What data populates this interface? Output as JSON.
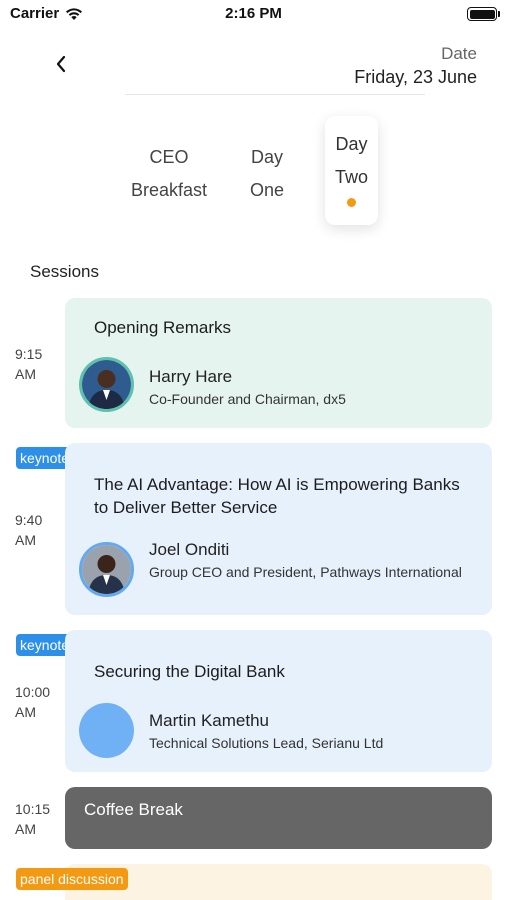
{
  "status_bar": {
    "carrier": "Carrier",
    "time": "2:16 PM"
  },
  "header": {
    "date_label": "Date",
    "date_value": "Friday, 23 June"
  },
  "tabs": [
    {
      "line1": "CEO",
      "line2": "Breakfast"
    },
    {
      "line1": "Day",
      "line2": "One"
    },
    {
      "line1": "Day",
      "line2": "Two"
    }
  ],
  "sessions_title": "Sessions",
  "sessions": [
    {
      "time": "9:15 AM",
      "title": "Opening Remarks",
      "speaker": "Harry Hare",
      "role": "Co-Founder and Chairman, dx5",
      "bg": "#e6f4f0"
    },
    {
      "badge": "keynote",
      "time": "9:40 AM",
      "title": "The AI Advantage: How AI is Empowering Banks to Deliver Better Service",
      "speaker": "Joel Onditi",
      "role": "Group CEO and President, Pathways International",
      "bg": "#e6f1fc"
    },
    {
      "badge": "keynote",
      "time": "10:00 AM",
      "title": "Securing the Digital Bank",
      "speaker": "Martin Kamethu",
      "role": "Technical Solutions Lead, Serianu Ltd",
      "bg": "#e6f1fc"
    },
    {
      "time": "10:15 AM",
      "title": "Coffee Break",
      "bg": "#666666"
    },
    {
      "badge": "panel discussion",
      "bg": "#fdf3e3"
    }
  ],
  "colors": {
    "keynote_badge": "#2d90e8",
    "panel_badge": "#f39a12",
    "active_dot": "#f39a12",
    "avatar_ring_green": "#5cc1ad",
    "avatar_ring_blue": "#63a9ee",
    "avatar_placeholder": "#6fb1f4"
  }
}
